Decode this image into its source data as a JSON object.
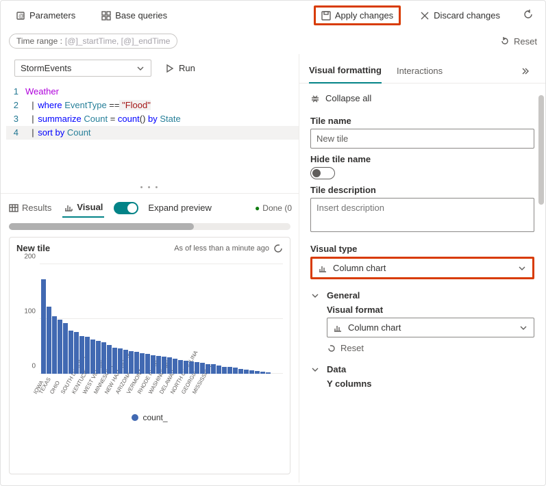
{
  "toolbar": {
    "parameters": "Parameters",
    "base_queries": "Base queries",
    "apply": "Apply changes",
    "discard": "Discard changes"
  },
  "time_range": {
    "prefix": "Time range :",
    "value": "[@]_startTime, [@]_endTime"
  },
  "reset_label": "Reset",
  "query": {
    "database": "StormEvents",
    "run": "Run",
    "lines": [
      {
        "n": "1",
        "tokens": [
          {
            "t": "Weather",
            "c": "tk-tbl"
          }
        ]
      },
      {
        "n": "2",
        "tokens": [
          {
            "t": "  | ",
            "c": "tk-pipe"
          },
          {
            "t": "where",
            "c": "tk-kw"
          },
          {
            "t": " EventType ",
            "c": "tk-col"
          },
          {
            "t": "==",
            "c": ""
          },
          {
            "t": " \"Flood\"",
            "c": "tk-str"
          }
        ]
      },
      {
        "n": "3",
        "tokens": [
          {
            "t": "  | ",
            "c": "tk-pipe"
          },
          {
            "t": "summarize",
            "c": "tk-kw"
          },
          {
            "t": " Count ",
            "c": "tk-col"
          },
          {
            "t": "=",
            "c": ""
          },
          {
            "t": " count",
            "c": "tk-fn"
          },
          {
            "t": "() ",
            "c": ""
          },
          {
            "t": "by",
            "c": "tk-kw"
          },
          {
            "t": " State",
            "c": "tk-col"
          }
        ]
      },
      {
        "n": "4",
        "tokens": [
          {
            "t": "  | ",
            "c": "tk-pipe"
          },
          {
            "t": "sort by",
            "c": "tk-kw"
          },
          {
            "t": " Count",
            "c": "tk-col"
          }
        ]
      }
    ]
  },
  "results_tabs": {
    "results": "Results",
    "visual": "Visual",
    "expand": "Expand preview",
    "done": "Done (0"
  },
  "tile": {
    "title": "New tile",
    "meta": "As of less than a minute ago"
  },
  "legend": "count_",
  "right": {
    "tab_vf": "Visual formatting",
    "tab_int": "Interactions",
    "collapse": "Collapse all",
    "tile_name_label": "Tile name",
    "tile_name_value": "New tile",
    "hide_label": "Hide tile name",
    "desc_label": "Tile description",
    "desc_placeholder": "Insert description",
    "vt_label": "Visual type",
    "vt_value": "Column chart",
    "general": "General",
    "vf_label": "Visual format",
    "vf_value": "Column chart",
    "reset": "Reset",
    "data": "Data",
    "ycols": "Y columns"
  },
  "chart_data": {
    "type": "bar",
    "title": "New tile",
    "ylabel": "",
    "xlabel": "",
    "ylim": [
      0,
      200
    ],
    "yticks": [
      0,
      100,
      200
    ],
    "series": [
      {
        "name": "count_",
        "values": [
          172,
          123,
          105,
          99,
          93,
          79,
          76,
          69,
          68,
          63,
          60,
          57,
          53,
          48,
          46,
          44,
          41,
          40,
          37,
          36,
          34,
          32,
          31,
          30,
          27,
          25,
          24,
          22,
          21,
          20,
          18,
          17,
          15,
          13,
          12,
          11,
          9,
          8,
          6,
          5,
          4,
          3
        ]
      }
    ],
    "categories": [
      "IOWA",
      "TEXAS",
      "",
      "OHIO",
      "",
      "SOUTH DAKOTA",
      "",
      "KENTUCKY",
      "",
      "WEST VIRGINIA",
      "",
      "MINNESOTA",
      "",
      "NEW HAMPSHIRE",
      "",
      "ARIZONA",
      "",
      "VERMONT",
      "",
      "RHODE ISLAND",
      "",
      "WASHINGTON",
      "",
      "DELAWARE",
      "",
      "NORTH CAROLINA",
      "",
      "GEORGIA",
      "",
      "MISSISSIPPI",
      "",
      "",
      "",
      "",
      "",
      "",
      "",
      "",
      "",
      "",
      "",
      ""
    ]
  }
}
